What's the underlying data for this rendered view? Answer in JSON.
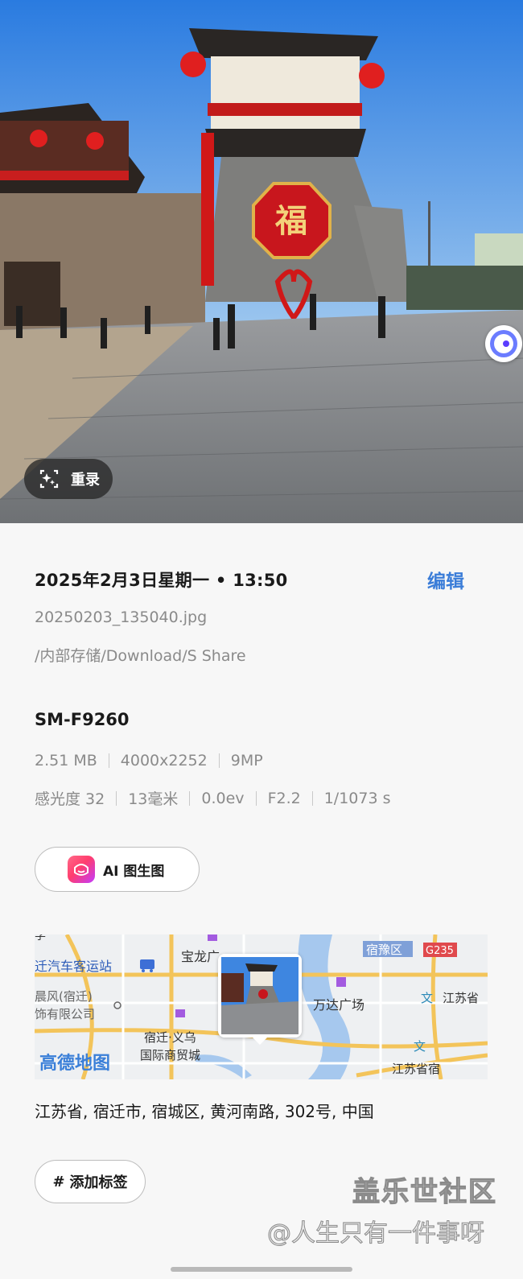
{
  "photo": {
    "remaster_label": "重录",
    "sign_char": "福"
  },
  "details": {
    "datetime": "2025年2月3日星期一 • 13:50",
    "edit_label": "编辑",
    "filename": "20250203_135040.jpg",
    "path": "/内部存储/Download/S Share",
    "device": "SM-F9260",
    "file_meta": [
      "2.51 MB",
      "4000x2252",
      "9MP"
    ],
    "camera_meta": [
      "感光度 32",
      "13毫米",
      "0.0ev",
      "F2.2",
      "1/1073 s"
    ]
  },
  "ai_button": {
    "label": "AI 图生图"
  },
  "map": {
    "labels": {
      "bus_station": "迁汽车客运站",
      "baolong": "宝龙广",
      "suyu": "宿豫区",
      "g235": "G235",
      "jingfeng_1": "晨风(宿迁)",
      "jingfeng_2": "饰有限公司",
      "wanda": "万达广场",
      "jiangsu_right": "江苏省",
      "yiwu_1": "宿迁·义乌",
      "yiwu_2": "国际商贸城",
      "jiangsu_bottom": "江苏省宿",
      "gaode": "高德地图",
      "top_left": "学"
    }
  },
  "address": "江苏省, 宿迁市, 宿城区, 黄河南路, 302号, 中国",
  "tag_button": {
    "hash": "#",
    "label": "添加标签"
  },
  "watermark": {
    "line1": "盖乐世社区",
    "line2": "@人生只有一件事呀"
  }
}
